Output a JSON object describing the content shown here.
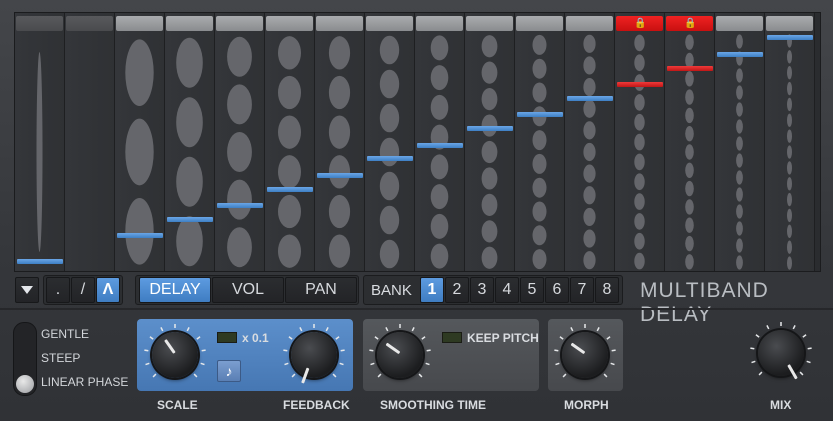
{
  "title": "MULTIBAND DELAY",
  "bands": [
    {
      "level": 0.03,
      "locked": false,
      "header": "dim"
    },
    {
      "level": null,
      "locked": false,
      "header": "dim"
    },
    {
      "level": 0.14,
      "locked": false,
      "header": "normal"
    },
    {
      "level": 0.21,
      "locked": false,
      "header": "normal"
    },
    {
      "level": 0.27,
      "locked": false,
      "header": "normal"
    },
    {
      "level": 0.34,
      "locked": false,
      "header": "normal"
    },
    {
      "level": 0.4,
      "locked": false,
      "header": "normal"
    },
    {
      "level": 0.47,
      "locked": false,
      "header": "normal"
    },
    {
      "level": 0.53,
      "locked": false,
      "header": "normal"
    },
    {
      "level": 0.6,
      "locked": false,
      "header": "normal"
    },
    {
      "level": 0.66,
      "locked": false,
      "header": "normal"
    },
    {
      "level": 0.73,
      "locked": false,
      "header": "normal"
    },
    {
      "level": 0.79,
      "locked": true,
      "header": "locked"
    },
    {
      "level": 0.86,
      "locked": true,
      "header": "locked"
    },
    {
      "level": 0.92,
      "locked": false,
      "header": "normal"
    },
    {
      "level": 0.99,
      "locked": false,
      "header": "normal"
    }
  ],
  "toolbar": {
    "dropdown_icon": "triangle-down-icon",
    "shapes": [
      ".",
      "/",
      "Λ"
    ],
    "active_shape": 2,
    "modes": [
      "DELAY",
      "VOL",
      "PAN"
    ],
    "active_mode": 0,
    "bank_label": "BANK",
    "banks": [
      "1",
      "2",
      "3",
      "4",
      "5",
      "6",
      "7",
      "8"
    ],
    "active_bank": 0
  },
  "slope": {
    "options": [
      "GENTLE",
      "STEEP",
      "LINEAR PHASE"
    ],
    "selected": 2
  },
  "controls": {
    "scale_label": "SCALE",
    "feedback_label": "FEEDBACK",
    "scale_mult_label": "x 0.1",
    "note_icon": "music-note-icon",
    "smoothing_label": "SMOOTHING TIME",
    "keep_pitch_label": "KEEP PITCH",
    "morph_label": "MORPH",
    "mix_label": "MIX"
  },
  "colors": {
    "accent": "#4a86c8",
    "locked": "#e01818"
  }
}
